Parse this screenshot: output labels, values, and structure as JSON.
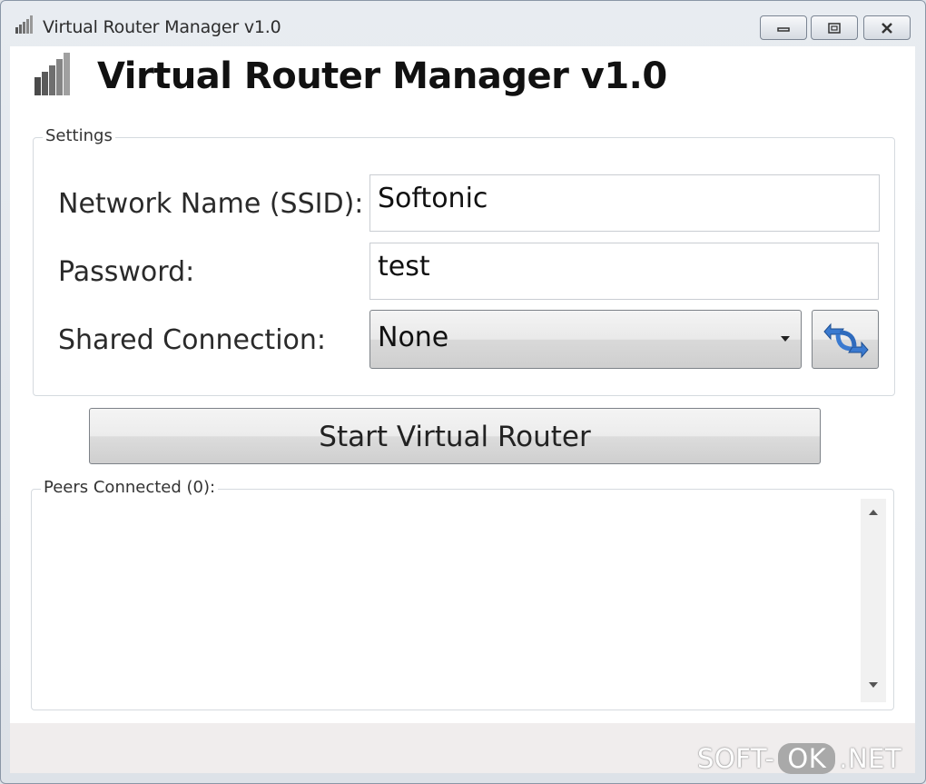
{
  "window": {
    "title": "Virtual Router Manager v1.0",
    "icon": "signal-bars-icon"
  },
  "header": {
    "title": "Virtual Router Manager v1.0",
    "icon": "signal-bars-icon"
  },
  "settings": {
    "legend": "Settings",
    "ssid_label": "Network Name (SSID):",
    "ssid_value": "Softonic",
    "password_label": "Password:",
    "password_value": "test",
    "shared_label": "Shared Connection:",
    "shared_value": "None",
    "refresh_icon": "refresh-arrows-icon"
  },
  "actions": {
    "start_label": "Start Virtual Router"
  },
  "peers": {
    "legend": "Peers Connected (0):"
  },
  "watermark": {
    "prefix": "SOFT-",
    "ok": "OK",
    "suffix": ".NET"
  },
  "colors": {
    "accent": "#3a7ad0",
    "window_border": "#8a96a6"
  }
}
